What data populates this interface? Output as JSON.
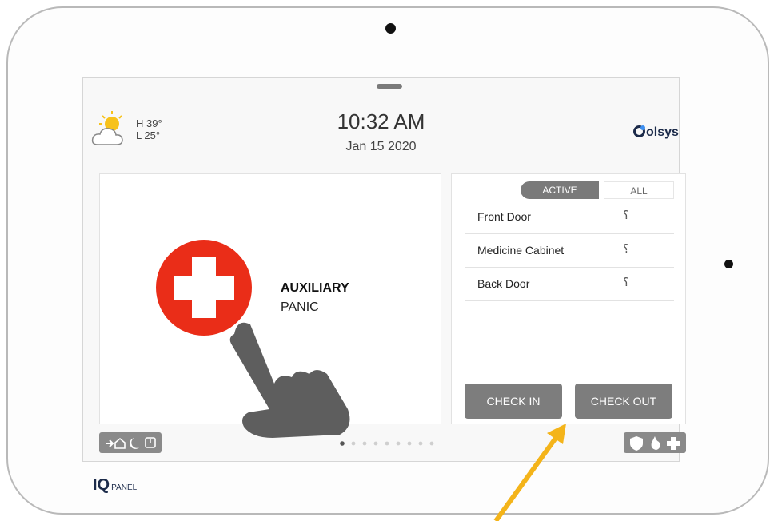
{
  "weather": {
    "high": "H 39°",
    "low": "L 25°",
    "icon": "partly-cloudy-icon"
  },
  "clock": {
    "time": "10:32 AM",
    "date": "Jan 15 2020"
  },
  "brand": {
    "name": "olsys"
  },
  "panic": {
    "line1": "AUXILIARY",
    "line2": "PANIC",
    "color": "#ea2d18"
  },
  "sensors_panel": {
    "tab_active": "ACTIVE",
    "tab_all": "ALL",
    "items": [
      {
        "label": "Front Door"
      },
      {
        "label": "Medicine Cabinet"
      },
      {
        "label": "Back Door"
      }
    ],
    "check_in": "CHECK IN",
    "check_out": "CHECK OUT"
  },
  "pager": {
    "current": 1,
    "total": 9
  },
  "device_logo": {
    "text": "PANEL"
  },
  "colors": {
    "button_gray": "#7d7d7d",
    "arrow": "#f4b41a"
  }
}
